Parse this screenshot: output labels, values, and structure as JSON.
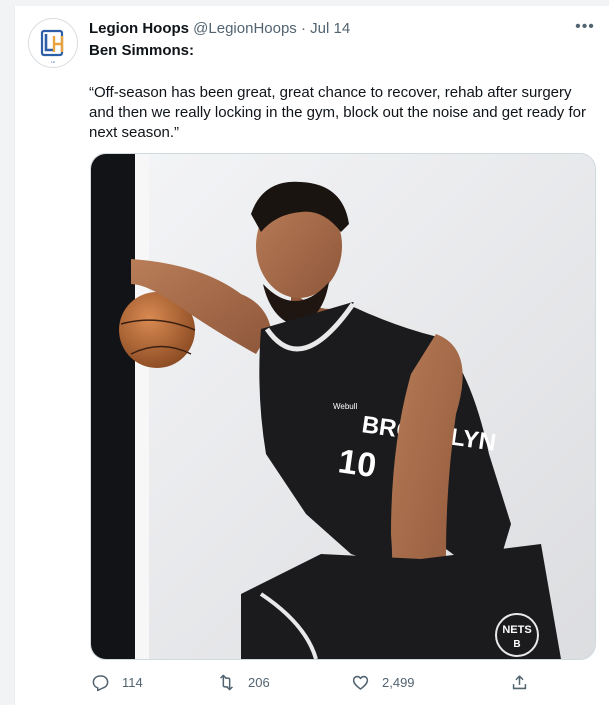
{
  "tweet": {
    "author_name": "Legion Hoops",
    "author_handle": "@LegionHoops",
    "separator": "·",
    "date": "Jul 14",
    "more_label": "•••",
    "headline": "Ben Simmons:",
    "quote": "“Off-season has been great, great chance to recover, rehab after surgery and then we really locking in the gym, block out the noise and get ready for next season.”",
    "avatar_logo_text": "LH",
    "media": {
      "jersey_text": "BROOKLYN",
      "jersey_number": "10",
      "sponsor": "Webull",
      "shorts_logo": "NETS",
      "shorts_logo_letter": "B"
    }
  },
  "actions": {
    "reply_count": "114",
    "retweet_count": "206",
    "like_count": "2,499"
  },
  "colors": {
    "text": "#0f1419",
    "secondary": "#536471",
    "border": "#cfd9de",
    "jersey": "#1b1b1e"
  }
}
